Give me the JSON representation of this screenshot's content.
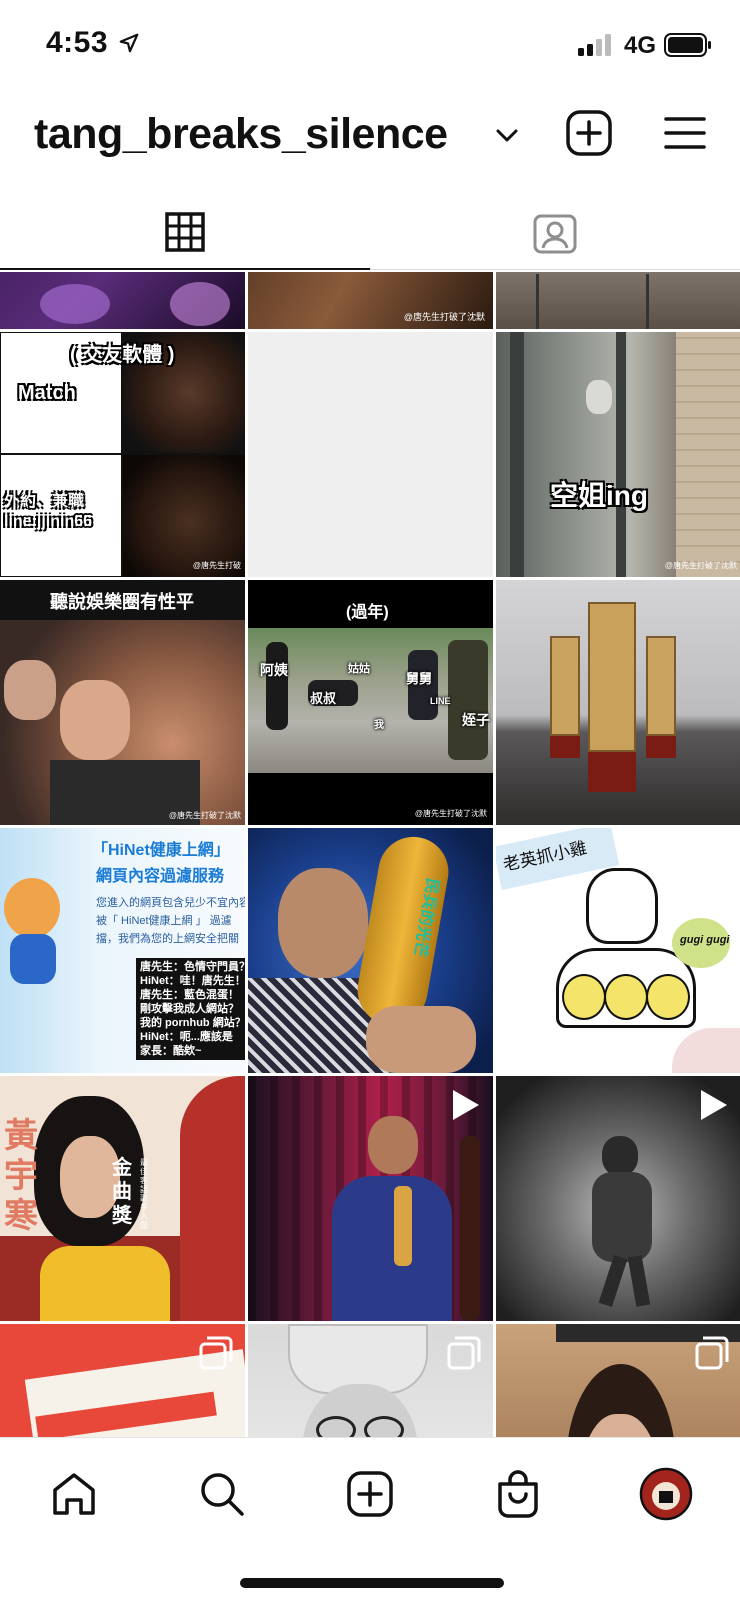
{
  "status_bar": {
    "time": "4:53",
    "network": "4G"
  },
  "profile": {
    "username": "tang_breaks_silence"
  },
  "tabs": [
    {
      "name": "grid"
    },
    {
      "name": "tagged"
    }
  ],
  "posts": [
    {
      "caption": ""
    },
    {
      "caption": "@唐先生打破了沈默"
    },
    {
      "caption": ""
    },
    {
      "title": "( 交友軟體 )",
      "left_top": "Match",
      "left_bottom": "外約、兼職\nline:jjinin66",
      "credit": "@唐先生打破"
    },
    {
      "caption": ""
    },
    {
      "caption": "空姐ing",
      "credit": "@唐先生打破了沈默"
    },
    {
      "title": "聽說娛樂圈有性平",
      "credit": "@唐先生打破了沈默"
    },
    {
      "title": "(過年)",
      "labels": [
        "阿姨",
        "姑姑",
        "舅舅",
        "叔叔",
        "LINE",
        "我",
        "姪子"
      ],
      "credit": "@唐先生打破了沈默"
    },
    {
      "caption": ""
    },
    {
      "heading": "「HiNet健康上網」",
      "subheading": "網頁內容過濾服務",
      "notice": "您進入的網頁包含兒少不宜內容\n被「 HiNet健康上網 」 過濾\n擋，我們為您的上網安全把關",
      "dialog": "唐先生：色情守門員？\nHiNet：哇！唐先生！\n唐先生：藍色混蛋！\n剛攻擊我成人網站？\n我的 pornhub 網站？\nHiNet：呃...應該是\n家長：酷欸~"
    },
    {
      "caption": "民兵的光芒"
    },
    {
      "caption": "老英抓小雞",
      "tag": "gugi gugi"
    },
    {
      "title": "黃宇寒",
      "subtitle": "金曲獎",
      "vertical": "最佳客語歌手 入圍"
    },
    {
      "caption": ""
    },
    {
      "caption": ""
    },
    {
      "caption": ""
    },
    {
      "caption": ""
    },
    {
      "caption": ""
    }
  ],
  "bottom_nav": [
    {
      "name": "home"
    },
    {
      "name": "search"
    },
    {
      "name": "new-post"
    },
    {
      "name": "shop"
    },
    {
      "name": "profile"
    }
  ],
  "colors": {
    "text": "#111111",
    "divider": "#dbdbdb"
  }
}
